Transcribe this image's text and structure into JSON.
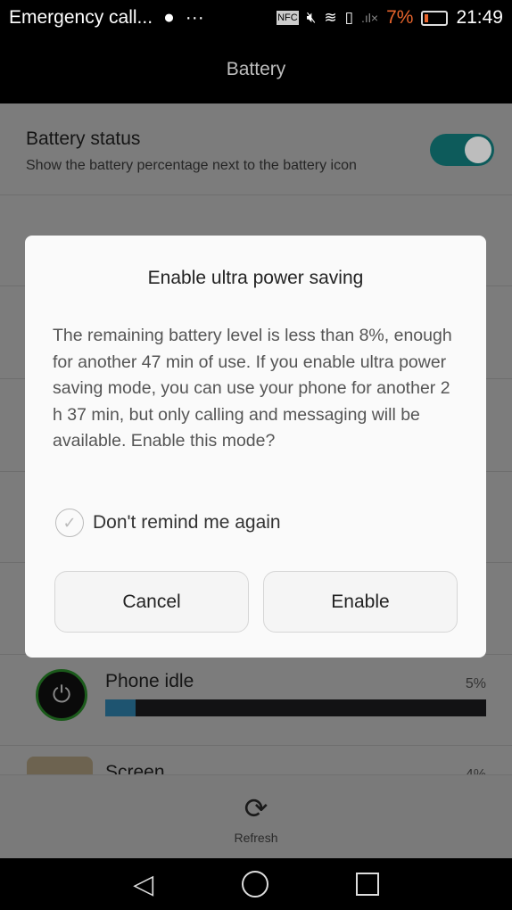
{
  "status_bar": {
    "notification": "Emergency call...",
    "battery_percent": "7%",
    "time": "21:49",
    "battery_color": "#e8642c"
  },
  "header": {
    "title": "Battery"
  },
  "settings": {
    "battery_status": {
      "title": "Battery status",
      "subtitle": "Show the battery percentage next to the battery icon",
      "enabled": true
    }
  },
  "usage": [
    {
      "name": "Phone idle",
      "percent": "5%",
      "fill": 5
    },
    {
      "name": "Screen",
      "percent": "4%"
    }
  ],
  "dialog": {
    "title": "Enable ultra power saving",
    "message": "The remaining battery level is less than 8%, enough for another 47 min of use. If you enable ultra power saving mode, you can use your phone for another 2 h 37 min, but only calling and messaging will be available. Enable this mode?",
    "checkbox_label": "Don't remind me again",
    "checked": false,
    "cancel": "Cancel",
    "enable": "Enable"
  },
  "bottom": {
    "refresh": "Refresh"
  }
}
